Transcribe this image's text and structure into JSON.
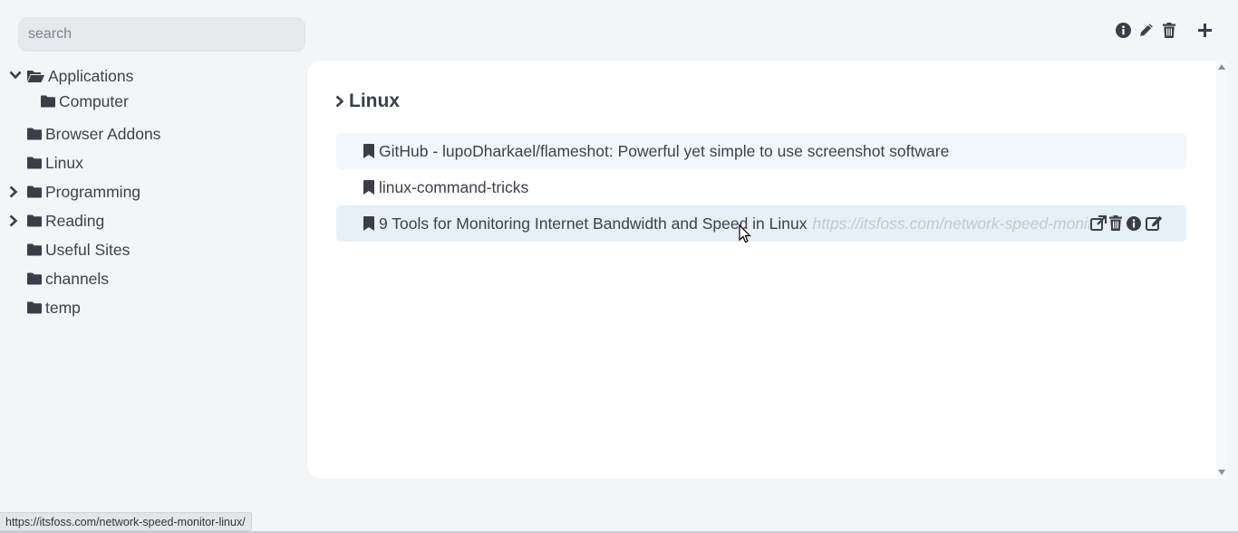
{
  "search": {
    "placeholder": "search"
  },
  "toolbar": {
    "icons": [
      "info-icon",
      "pencil-icon",
      "trash-icon",
      "plus-icon"
    ]
  },
  "sidebar": {
    "items": [
      {
        "label": "Applications",
        "expanded": true,
        "icon": "folder-open-icon"
      },
      {
        "label": "Computer",
        "icon": "folder-icon"
      },
      {
        "label": "Browser Addons",
        "icon": "folder-icon"
      },
      {
        "label": "Linux",
        "icon": "folder-icon"
      },
      {
        "label": "Programming",
        "collapsed": true,
        "icon": "folder-icon"
      },
      {
        "label": "Reading",
        "collapsed": true,
        "icon": "folder-icon"
      },
      {
        "label": "Useful Sites",
        "icon": "folder-icon"
      },
      {
        "label": "channels",
        "icon": "folder-icon"
      },
      {
        "label": "temp",
        "icon": "folder-icon"
      }
    ]
  },
  "main": {
    "group_title": "Linux",
    "bookmarks": [
      {
        "title": "GitHub - lupoDharkael/flameshot: Powerful yet simple to use screenshot software"
      },
      {
        "title": "linux-command-tricks"
      },
      {
        "title": "9 Tools for Monitoring Internet Bandwidth and Speed in Linux",
        "url": "https://itsfoss.com/network-speed-monitor-linux/"
      }
    ]
  },
  "status": {
    "url": "https://itsfoss.com/network-speed-monitor-linux/"
  },
  "colors": {
    "panel": "#ffffff",
    "background": "#f3f5f7",
    "row_hover": "#e6f0f8",
    "row_light": "#f1f7fb"
  }
}
